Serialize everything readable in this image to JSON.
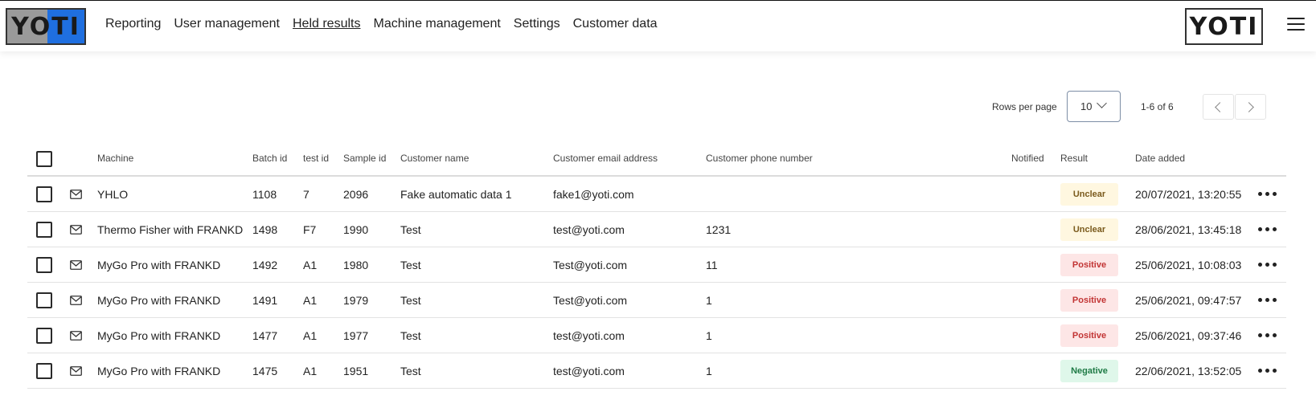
{
  "header": {
    "logo_left_text": "YOTI",
    "logo_right_text": "YOTI",
    "nav": [
      {
        "label": "Reporting",
        "active": false
      },
      {
        "label": "User management",
        "active": false
      },
      {
        "label": "Held results",
        "active": true
      },
      {
        "label": "Machine management",
        "active": false
      },
      {
        "label": "Settings",
        "active": false
      },
      {
        "label": "Customer data",
        "active": false
      }
    ],
    "menu_icon": "hamburger-icon"
  },
  "pagination": {
    "rows_per_page_label": "Rows per page",
    "rows_per_page_value": "10",
    "range": "1-6 of 6",
    "prev_icon": "chevron-left-icon",
    "next_icon": "chevron-right-icon"
  },
  "table": {
    "columns": {
      "machine": "Machine",
      "batch_id": "Batch id",
      "test_id": "test id",
      "sample_id": "Sample id",
      "customer_name": "Customer name",
      "email": "Customer email address",
      "phone": "Customer phone number",
      "notified": "Notified",
      "result": "Result",
      "date_added": "Date added"
    },
    "rows": [
      {
        "machine": "YHLO",
        "batch_id": "1108",
        "test_id": "7",
        "sample_id": "2096",
        "customer_name": "Fake automatic data 1",
        "email": "fake1@yoti.com",
        "phone": "",
        "notified": "",
        "result": "Unclear",
        "result_status": "unclear",
        "date_added": "20/07/2021, 13:20:55"
      },
      {
        "machine": "Thermo Fisher with FRANKD",
        "batch_id": "1498",
        "test_id": "F7",
        "sample_id": "1990",
        "customer_name": "Test",
        "email": "test@yoti.com",
        "phone": "1231",
        "notified": "",
        "result": "Unclear",
        "result_status": "unclear",
        "date_added": "28/06/2021, 13:45:18"
      },
      {
        "machine": "MyGo Pro with FRANKD",
        "batch_id": "1492",
        "test_id": "A1",
        "sample_id": "1980",
        "customer_name": "Test",
        "email": "Test@yoti.com",
        "phone": "11",
        "notified": "",
        "result": "Positive",
        "result_status": "positive",
        "date_added": "25/06/2021, 10:08:03"
      },
      {
        "machine": "MyGo Pro with FRANKD",
        "batch_id": "1491",
        "test_id": "A1",
        "sample_id": "1979",
        "customer_name": "Test",
        "email": "Test@yoti.com",
        "phone": "1",
        "notified": "",
        "result": "Positive",
        "result_status": "positive",
        "date_added": "25/06/2021, 09:47:57"
      },
      {
        "machine": "MyGo Pro with FRANKD",
        "batch_id": "1477",
        "test_id": "A1",
        "sample_id": "1977",
        "customer_name": "Test",
        "email": "test@yoti.com",
        "phone": "1",
        "notified": "",
        "result": "Positive",
        "result_status": "positive",
        "date_added": "25/06/2021, 09:37:46"
      },
      {
        "machine": "MyGo Pro with FRANKD",
        "batch_id": "1475",
        "test_id": "A1",
        "sample_id": "1951",
        "customer_name": "Test",
        "email": "test@yoti.com",
        "phone": "1",
        "notified": "",
        "result": "Negative",
        "result_status": "negative",
        "date_added": "22/06/2021, 13:52:05"
      }
    ],
    "row_icon": "mail-icon",
    "row_action_icon": "more-options-icon"
  },
  "colors": {
    "brand_blue": "#1f6fe0",
    "unclear_bg": "#fff7e0",
    "positive_bg": "#fde6e6",
    "negative_bg": "#dff7ea"
  }
}
